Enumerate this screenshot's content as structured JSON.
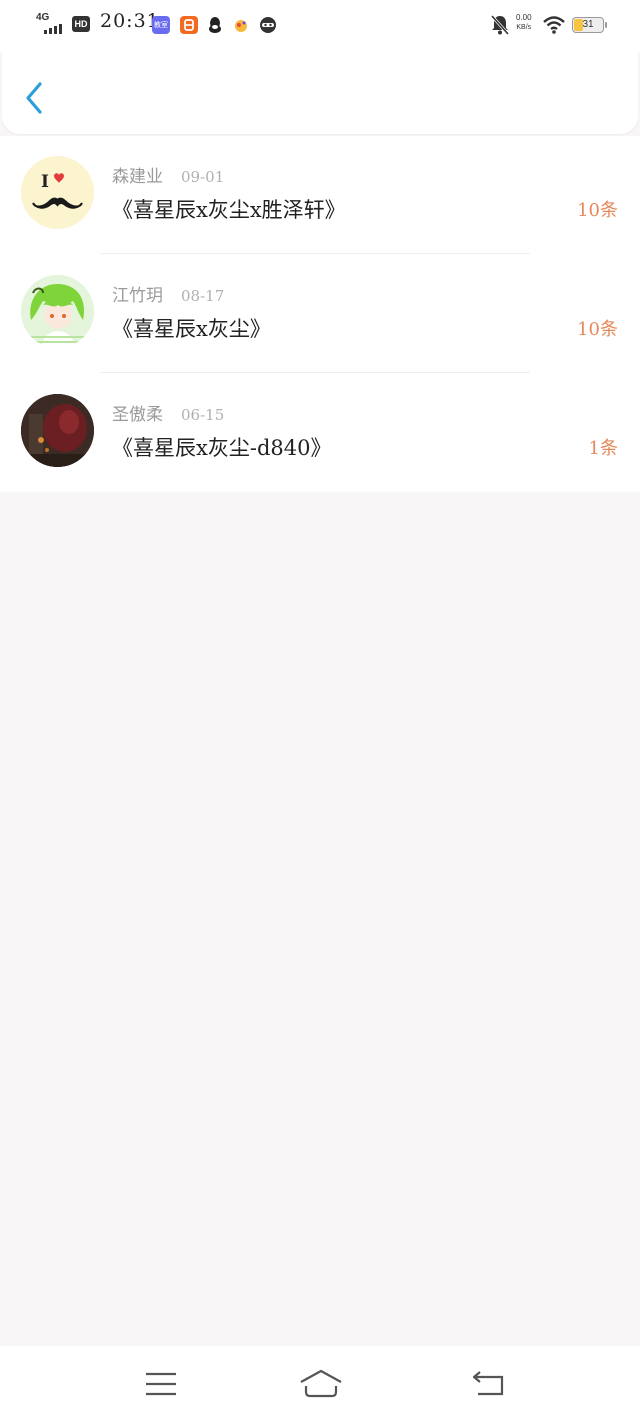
{
  "status_bar": {
    "network": "4G",
    "hd": "HD",
    "time": "20:31",
    "apps": [
      {
        "name": "app1-icon",
        "label": "教室",
        "color": "#6a6cf0"
      },
      {
        "name": "app2-icon",
        "label": "",
        "color": "#f26a21"
      },
      {
        "name": "qq-icon",
        "label": "",
        "color": "#222222"
      },
      {
        "name": "app4-icon",
        "label": "",
        "color": "#f6b93b"
      },
      {
        "name": "app5-icon",
        "label": "",
        "color": "#333333"
      }
    ],
    "net_speed_value": "0.00",
    "net_speed_unit": "KB/s",
    "battery_level": "31",
    "battery_fraction": 0.31
  },
  "header": {
    "back_icon": "chevron-left-icon"
  },
  "list": [
    {
      "user": "森建业",
      "date": "09-01",
      "title": "《喜星辰x灰尘x胜泽轩》",
      "count": "10条",
      "avatar": "mustache-heart-avatar"
    },
    {
      "user": "江竹玥",
      "date": "08-17",
      "title": "《喜星辰x灰尘》",
      "count": "10条",
      "avatar": "anime-green-hair-avatar"
    },
    {
      "user": "圣傲柔",
      "date": "06-15",
      "title": "《喜星辰x灰尘-d840》",
      "count": "1条",
      "avatar": "dark-photo-avatar"
    }
  ],
  "colors": {
    "accent": "#2a9fd8",
    "count": "#e5885a",
    "background": "#f8f6f7"
  },
  "nav": {
    "menu_icon": "menu-icon",
    "home_icon": "home-icon",
    "back_icon": "return-icon"
  }
}
